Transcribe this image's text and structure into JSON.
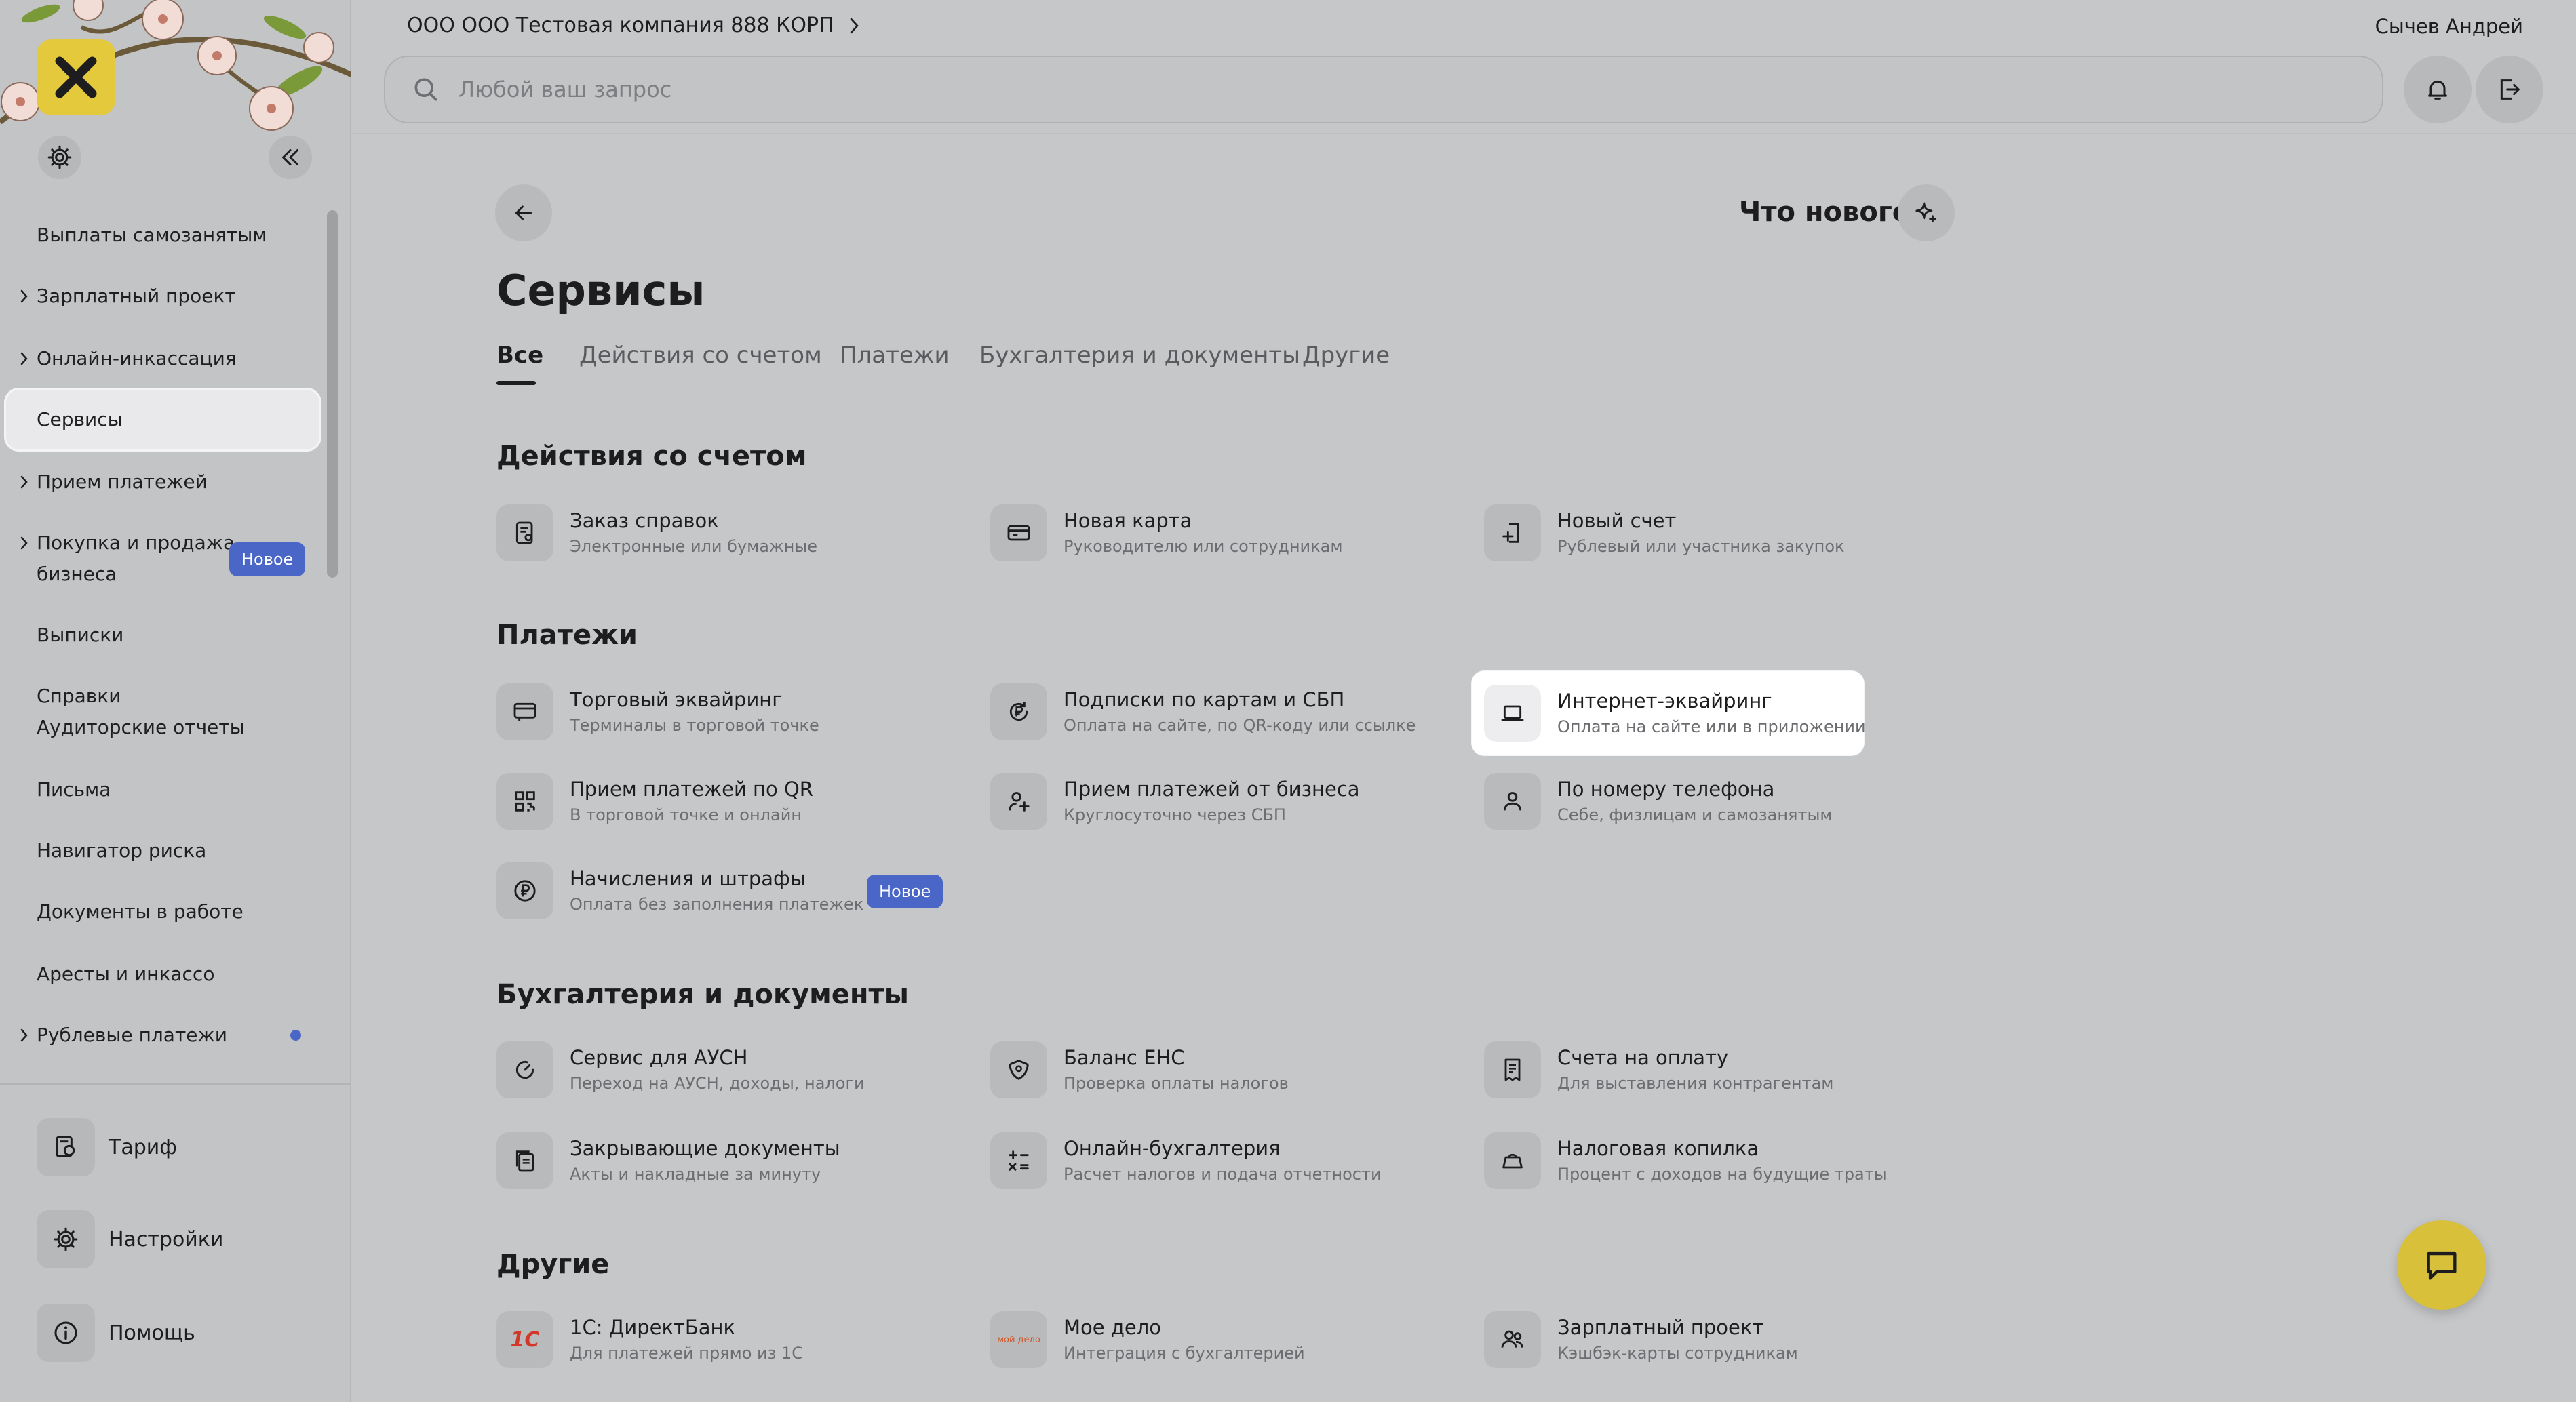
{
  "header": {
    "company": "ООО ООО Тестовая компания 888 КОРП",
    "user": "Сычев Андрей",
    "search_placeholder": "Любой ваш запрос"
  },
  "sidebar": {
    "items": [
      {
        "label": "Выплаты самозанятым"
      },
      {
        "label": "Зарплатный проект"
      },
      {
        "label": "Онлайн-инкассация"
      },
      {
        "label": "Сервисы"
      },
      {
        "label": "Прием платежей"
      },
      {
        "label_line1": "Покупка и продажа",
        "label_line2": "бизнеса",
        "badge": "Новое"
      },
      {
        "label": "Выписки"
      },
      {
        "label_line1": "Справки",
        "label_line2": "Аудиторские отчеты"
      },
      {
        "label": "Письма"
      },
      {
        "label": "Навигатор риска"
      },
      {
        "label": "Документы в работе"
      },
      {
        "label": "Аресты и инкассо"
      },
      {
        "label": "Рублевые платежи"
      }
    ],
    "bottom": [
      {
        "label": "Тариф"
      },
      {
        "label": "Настройки"
      },
      {
        "label": "Помощь"
      }
    ]
  },
  "main": {
    "whats_new": "Что нового",
    "title": "Сервисы",
    "tabs": [
      "Все",
      "Действия со счетом",
      "Платежи",
      "Бухгалтерия и документы",
      "Другие"
    ],
    "sections": {
      "account": {
        "title": "Действия со счетом",
        "items": [
          {
            "title": "Заказ справок",
            "subtitle": "Электронные или бумажные"
          },
          {
            "title": "Новая карта",
            "subtitle": "Руководителю или сотрудникам"
          },
          {
            "title": "Новый счет",
            "subtitle": "Рублевый или участника закупок"
          }
        ]
      },
      "payments": {
        "title": "Платежи",
        "items": [
          {
            "title": "Торговый эквайринг",
            "subtitle": "Терминалы в торговой точке"
          },
          {
            "title": "Подписки по картам и СБП",
            "subtitle": "Оплата на сайте, по QR-коду или ссылке"
          },
          {
            "title": "Интернет-эквайринг",
            "subtitle": "Оплата на сайте или в приложении"
          },
          {
            "title": "Прием платежей по QR",
            "subtitle": "В торговой точке и онлайн"
          },
          {
            "title": "Прием платежей от бизнеса",
            "subtitle": "Круглосуточно через СБП"
          },
          {
            "title": "По номеру телефона",
            "subtitle": "Себе, физлицам и самозанятым"
          },
          {
            "title": "Начисления и штрафы",
            "subtitle": "Оплата без заполнения платежек",
            "badge": "Новое"
          }
        ]
      },
      "accounting": {
        "title": "Бухгалтерия и документы",
        "items": [
          {
            "title": "Сервис для АУСН",
            "subtitle": "Переход на АУСН, доходы, налоги"
          },
          {
            "title": "Баланс ЕНС",
            "subtitle": "Проверка оплаты налогов"
          },
          {
            "title": "Счета на оплату",
            "subtitle": "Для выставления контрагентам"
          },
          {
            "title": "Закрывающие документы",
            "subtitle": "Акты и накладные за минуту"
          },
          {
            "title": "Онлайн-бухгалтерия",
            "subtitle": "Расчет налогов и подача отчетности"
          },
          {
            "title": "Налоговая копилка",
            "subtitle": "Процент с доходов на будущие траты"
          }
        ]
      },
      "other": {
        "title": "Другие",
        "items": [
          {
            "title": "1С: ДиректБанк",
            "subtitle": "Для платежей прямо из 1С",
            "logo": "1С"
          },
          {
            "title": "Мое дело",
            "subtitle": "Интеграция с бухгалтерией",
            "logo": "мой дело"
          },
          {
            "title": "Зарплатный проект",
            "subtitle": "Кэшбэк-карты сотрудникам"
          }
        ]
      }
    }
  },
  "colors": {
    "accent_yellow": "#e3c93b",
    "badge_blue": "#4a66c6",
    "background": "#c6c7c9"
  }
}
